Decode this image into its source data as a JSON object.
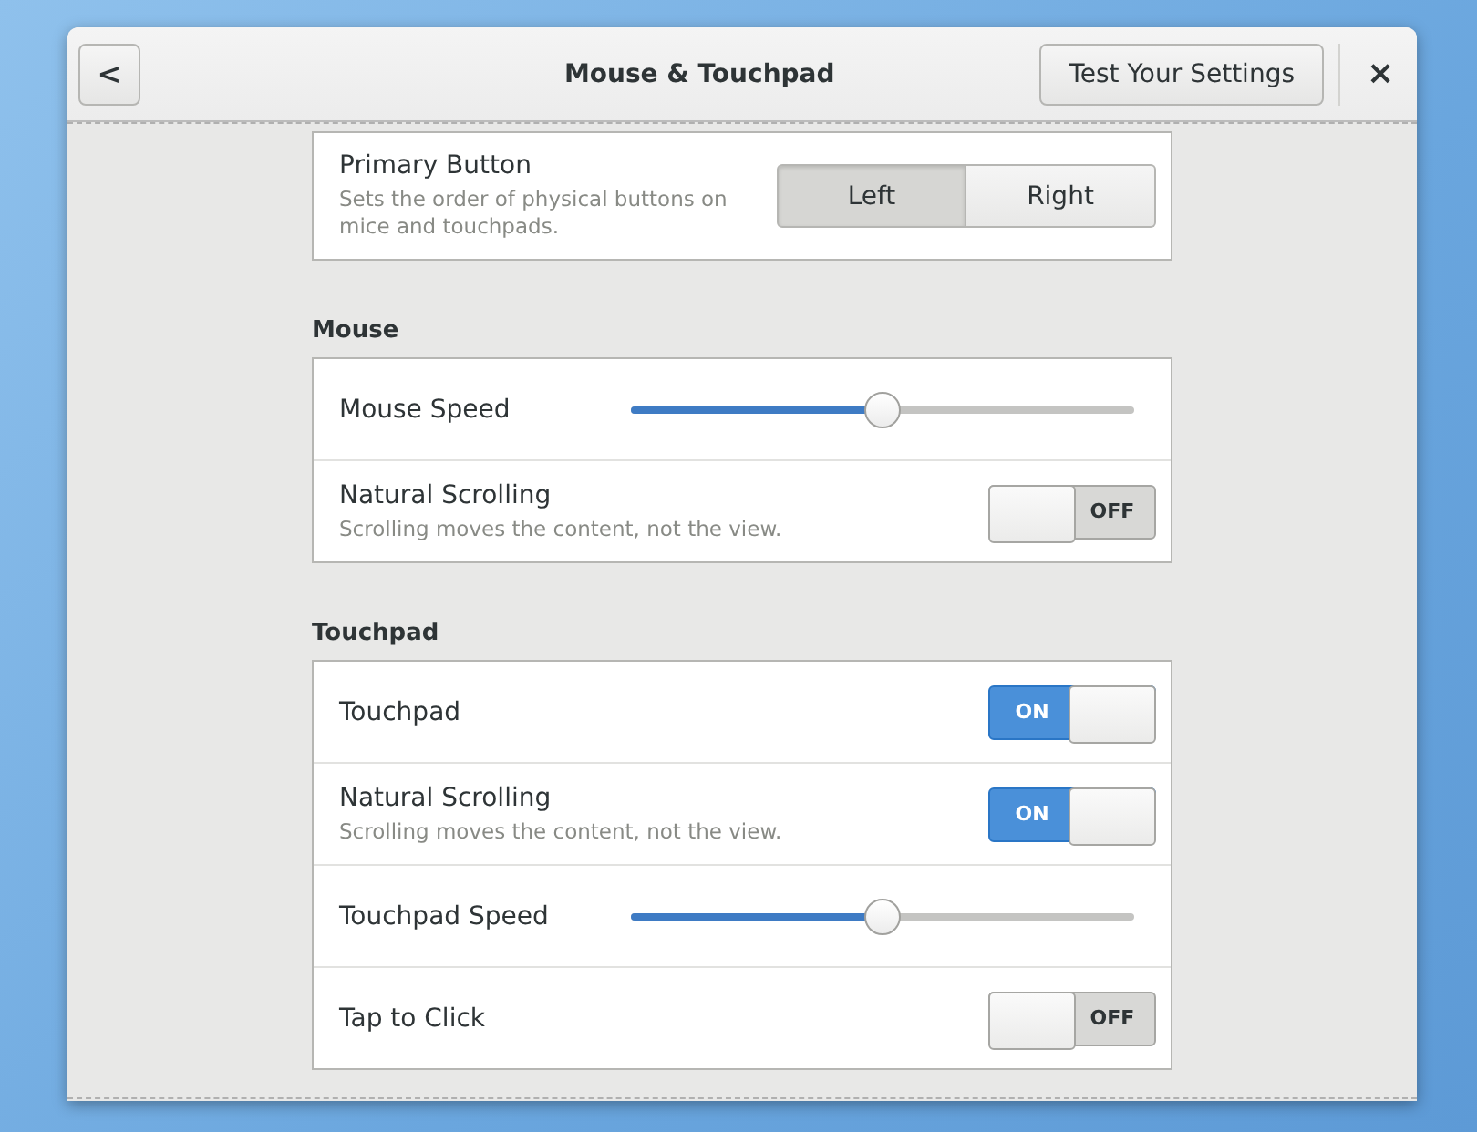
{
  "window": {
    "title": "Mouse & Touchpad",
    "back_button": "<",
    "test_button": "Test Your Settings",
    "close_button": "×"
  },
  "sections": [
    {
      "rows": [
        {
          "kind": "choice",
          "label": "Primary Button",
          "description": "Sets the order of physical buttons on mice and touchpads.",
          "options": [
            {
              "label": "Left",
              "selected": true
            },
            {
              "label": "Right",
              "selected": false
            }
          ]
        }
      ]
    },
    {
      "heading": "Mouse",
      "rows": [
        {
          "kind": "slider",
          "label": "Mouse Speed",
          "level": 0.5
        },
        {
          "kind": "switch",
          "label": "Natural Scrolling",
          "description": "Scrolling moves the content, not the view.",
          "on": false,
          "state_text": "OFF"
        }
      ]
    },
    {
      "heading": "Touchpad",
      "rows": [
        {
          "kind": "switch",
          "label": "Touchpad",
          "on": true,
          "state_text": "ON"
        },
        {
          "kind": "switch",
          "label": "Natural Scrolling",
          "description": "Scrolling moves the content, not the view.",
          "on": true,
          "state_text": "ON"
        },
        {
          "kind": "slider",
          "label": "Touchpad Speed",
          "level": 0.5
        },
        {
          "kind": "switch",
          "label": "Tap to Click",
          "on": false,
          "state_text": "OFF"
        }
      ]
    }
  ]
}
